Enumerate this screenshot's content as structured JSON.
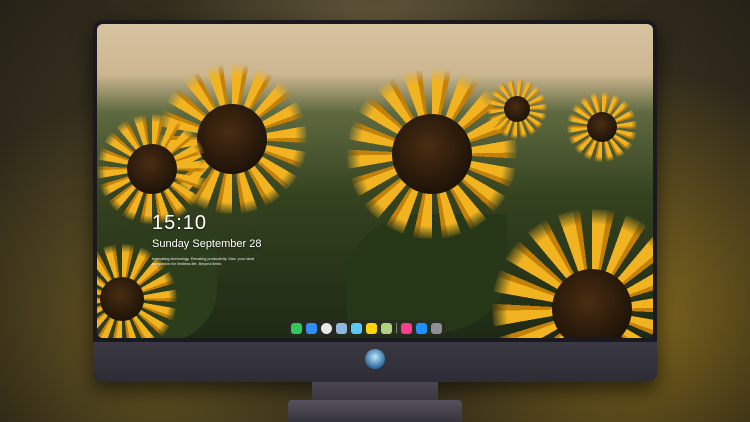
{
  "lock_screen": {
    "time": "15:10",
    "date": "Sunday September 28",
    "tagline": "Innovating technology. Elevating productivity. Mac: your ideal companion for limitless life. Beyond limits"
  },
  "dock": {
    "apps": [
      {
        "icon": "messages-icon",
        "color": "#34c759"
      },
      {
        "icon": "finder-icon",
        "color": "#2f8ef5"
      },
      {
        "icon": "safari-icon",
        "color": "#e8e8e8"
      },
      {
        "icon": "preview-icon",
        "color": "#8fb8e0"
      },
      {
        "icon": "clapper-icon",
        "color": "#5ac8fa"
      },
      {
        "icon": "notes-icon",
        "color": "#ffd60a"
      },
      {
        "icon": "photos-icon",
        "color": "#b0d080"
      },
      {
        "icon": "music-icon",
        "color": "#fc3c8d"
      },
      {
        "icon": "app-store-icon",
        "color": "#1e90ff"
      },
      {
        "icon": "screenshot-icon",
        "color": "#8e8e93"
      }
    ]
  },
  "monitor": {
    "logo_icon": "apple-logo-icon"
  }
}
